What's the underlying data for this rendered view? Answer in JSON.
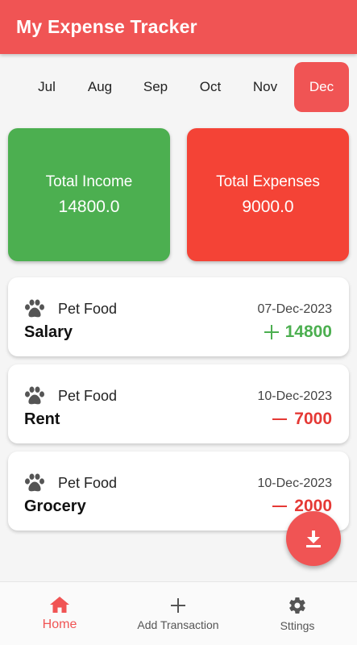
{
  "app": {
    "title": "My Expense Tracker",
    "accent": "#f05454"
  },
  "months": [
    "Jul",
    "Aug",
    "Sep",
    "Oct",
    "Nov",
    "Dec"
  ],
  "selected_month": "Dec",
  "summary": {
    "income_label": "Total Income",
    "income_value": "14800.0",
    "income_color": "#4caf50",
    "expense_label": "Total Expenses",
    "expense_value": "9000.0",
    "expense_color": "#f44336"
  },
  "transactions": [
    {
      "category": "Pet Food",
      "icon": "paw-icon",
      "date": "07-Dec-2023",
      "title": "Salary",
      "type": "income",
      "amount": "14800"
    },
    {
      "category": "Pet Food",
      "icon": "paw-icon",
      "date": "10-Dec-2023",
      "title": "Rent",
      "type": "expense",
      "amount": "7000"
    },
    {
      "category": "Pet Food",
      "icon": "paw-icon",
      "date": "10-Dec-2023",
      "title": "Grocery",
      "type": "expense",
      "amount": "2000"
    }
  ],
  "fab": {
    "icon": "download-icon"
  },
  "nav": {
    "items": [
      {
        "label": "Home",
        "icon": "home-icon",
        "active": true
      },
      {
        "label": "Add Transaction",
        "icon": "plus-icon",
        "active": false
      },
      {
        "label": "Sttings",
        "icon": "gear-icon",
        "active": false
      }
    ]
  }
}
